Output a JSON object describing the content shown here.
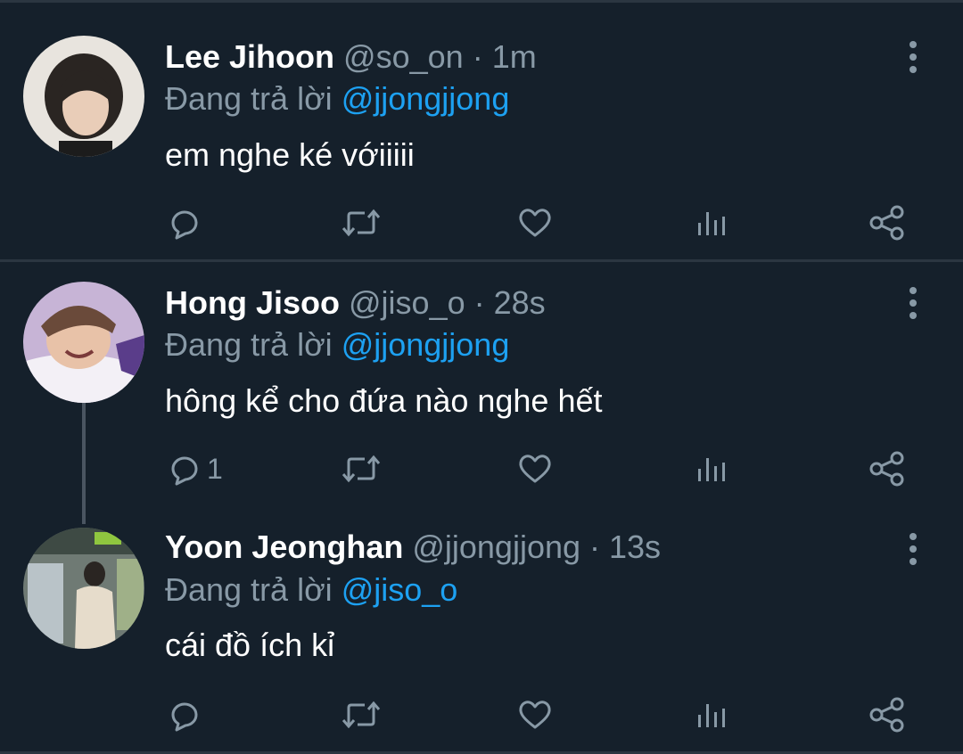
{
  "tweets": [
    {
      "name": "Lee Jihoon",
      "handle": "@so_on",
      "sep": " · ",
      "time": "1m",
      "reply_prefix": "Đang trả lời ",
      "reply_to": "@jjongjjong",
      "text": "em nghe ké vớiiiii",
      "reply_count": ""
    },
    {
      "name": "Hong Jisoo",
      "handle": "@jiso_o",
      "sep": " · ",
      "time": "28s",
      "reply_prefix": "Đang trả lời ",
      "reply_to": "@jjongjjong",
      "text": "hông kể cho đứa nào nghe hết",
      "reply_count": "1"
    },
    {
      "name": "Yoon Jeonghan",
      "handle": "@jjongjjong",
      "sep": " · ",
      "time": "13s",
      "reply_prefix": "Đang trả lời ",
      "reply_to": "@jiso_o",
      "text": "cái đồ ích kỉ",
      "reply_count": ""
    }
  ],
  "colors": {
    "background": "#15202b",
    "muted": "#8899a6",
    "accent": "#1da1f2"
  },
  "icons": [
    "reply-icon",
    "retweet-icon",
    "like-icon",
    "analytics-icon",
    "share-icon",
    "more-icon"
  ]
}
